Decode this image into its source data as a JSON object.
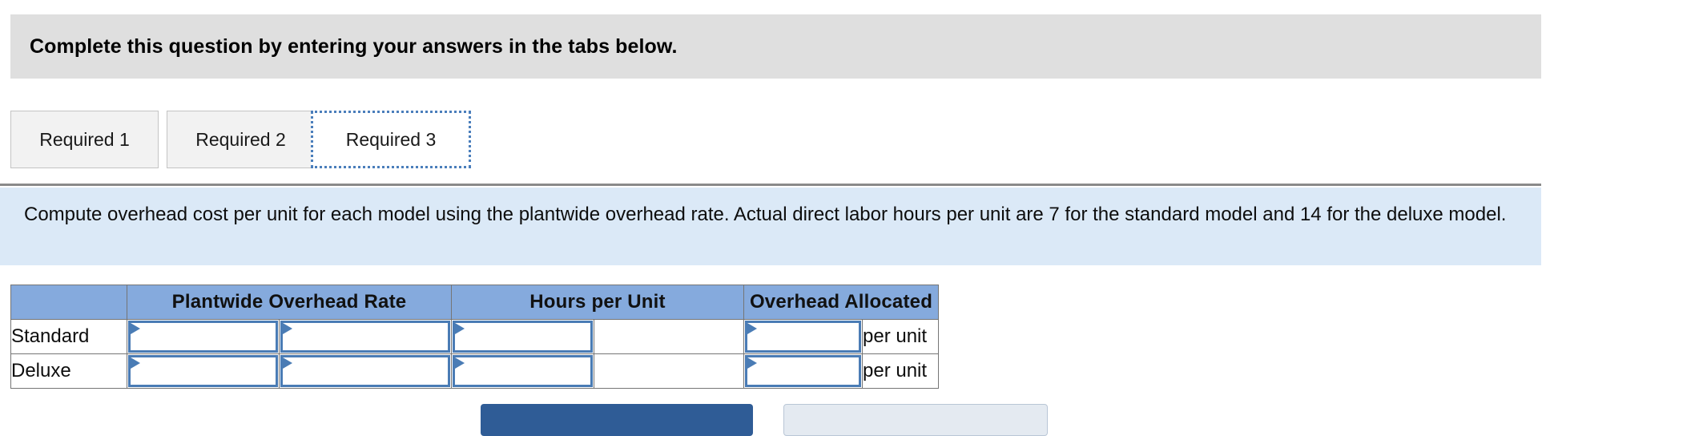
{
  "banner": {
    "text": "Complete this question by entering your answers in the tabs below."
  },
  "tabs": {
    "items": [
      {
        "label": "Required 1",
        "active": false
      },
      {
        "label": "Required 2",
        "active": false
      },
      {
        "label": "Required 3",
        "active": true
      }
    ]
  },
  "instructions": {
    "text": "Compute overhead cost per unit for each model using the plantwide overhead rate. Actual direct labor hours per unit are 7 for the standard model and 14 for the deluxe model."
  },
  "table": {
    "headers": [
      "",
      "Plantwide Overhead Rate",
      "Hours per Unit",
      "Overhead Allocated"
    ],
    "rows": [
      {
        "label": "Standard",
        "rate_numerator": "",
        "rate_denominator": "",
        "hours_input": "",
        "hours_blank": "",
        "allocated": "",
        "unit_label": "per unit"
      },
      {
        "label": "Deluxe",
        "rate_numerator": "",
        "rate_denominator": "",
        "hours_input": "",
        "hours_blank": "",
        "allocated": "",
        "unit_label": "per unit"
      }
    ]
  },
  "footer_buttons": {
    "primary_label": "",
    "secondary_label": ""
  },
  "colors": {
    "banner_bg": "#dfdfdf",
    "instruction_bg": "#dbe9f7",
    "table_header_bg": "#85aadd",
    "input_border": "#4a7cb5",
    "tab_focus": "#4a7ebb",
    "primary_button": "#2f5c96"
  }
}
